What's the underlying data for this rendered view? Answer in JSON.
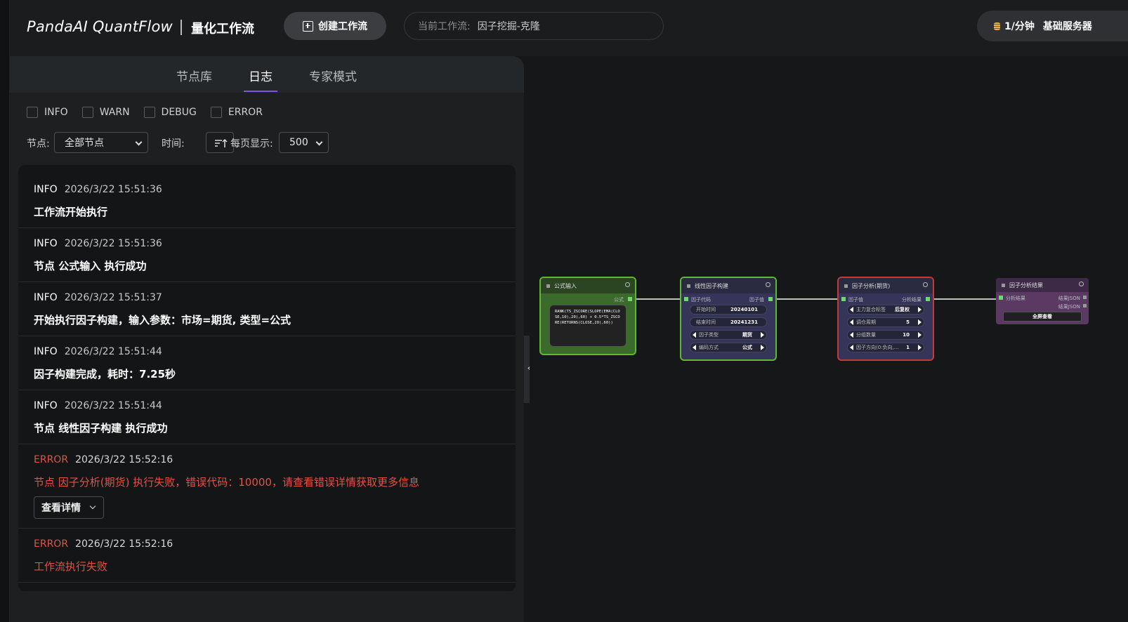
{
  "header": {
    "brand": "PandaAI QuantFlow",
    "subtitle": "量化工作流",
    "create_label": "创建工作流",
    "current_label": "当前工作流:",
    "current_value": "因子挖掘-克隆",
    "rate_label": "1/分钟",
    "server_label": "基础服务器"
  },
  "tabs": [
    {
      "label": "节点库",
      "active": false
    },
    {
      "label": "日志",
      "active": true
    },
    {
      "label": "专家模式",
      "active": false
    }
  ],
  "filters": [
    "INFO",
    "WARN",
    "DEBUG",
    "ERROR"
  ],
  "controls": {
    "node_label": "节点:",
    "node_value": "全部节点",
    "time_label": "时间:",
    "page_label": "每页显示:",
    "page_value": "500"
  },
  "logs": [
    {
      "level": "INFO",
      "time": "2026/3/22 15:51:36",
      "message": "工作流开始执行"
    },
    {
      "level": "INFO",
      "time": "2026/3/22 15:51:36",
      "message": "节点 公式输入 执行成功"
    },
    {
      "level": "INFO",
      "time": "2026/3/22 15:51:37",
      "message": "开始执行因子构建，输入参数：市场=期货, 类型=公式"
    },
    {
      "level": "INFO",
      "time": "2026/3/22 15:51:44",
      "message": "因子构建完成，耗时：7.25秒"
    },
    {
      "level": "INFO",
      "time": "2026/3/22 15:51:44",
      "message": "节点 线性因子构建 执行成功"
    },
    {
      "level": "ERROR",
      "time": "2026/3/22 15:52:16",
      "message": "节点 因子分析(期货) 执行失败，错误代码：10000，请查看错误详情获取更多信息",
      "detail_label": "查看详情"
    },
    {
      "level": "ERROR",
      "time": "2026/3/22 15:52:16",
      "message": "工作流执行失败"
    }
  ],
  "nodes": {
    "formula": {
      "title": "公式输入",
      "out_label": "公式",
      "formula": "RANK(TS_ZSCORE(SLOPE(EMA(CLOSE,10),20),60) + 0.5*TS_ZSCORE(RETURNS(CLOSE,20),60))"
    },
    "linear": {
      "title": "线性因子构建",
      "in_label": "因子代码",
      "out_label": "因子值",
      "fields": [
        {
          "label": "开始时间",
          "value": "20240101"
        },
        {
          "label": "结束时间",
          "value": "20241231"
        },
        {
          "label": "因子类型",
          "value": "期货"
        },
        {
          "label": "编码方式",
          "value": "公式"
        }
      ]
    },
    "analysis": {
      "title": "因子分析(期货)",
      "in_label": "因子值",
      "out_label": "分析结果",
      "fields": [
        {
          "label": "主力复合标签",
          "value": "后复权"
        },
        {
          "label": "调仓周期",
          "value": "5"
        },
        {
          "label": "分组数量",
          "value": "10"
        },
        {
          "label": "因子方向(0:负向,...",
          "value": "1"
        }
      ]
    },
    "result": {
      "title": "因子分析结果",
      "in_label": "分析结果",
      "out1": "结果JSON",
      "out2": "结果JSON",
      "button": "全屏查看"
    }
  },
  "colors": {
    "accent": "#7a55e6",
    "error": "#e0524a",
    "node_green": "#5fb832",
    "node_red": "#c5383a",
    "node_purple": "#5a3a63"
  }
}
